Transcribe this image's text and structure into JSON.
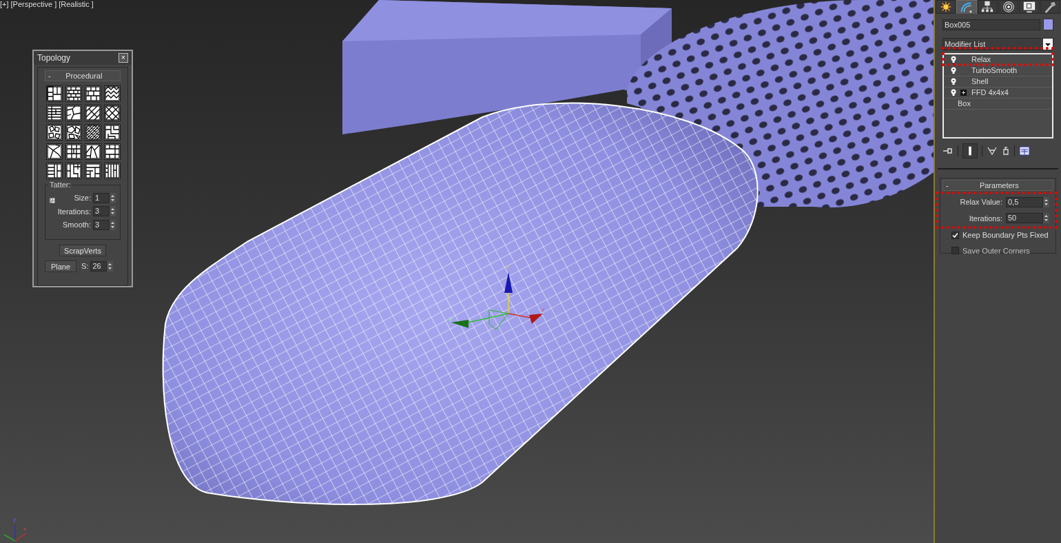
{
  "viewport": {
    "labels": [
      "[+]",
      "[Perspective ]",
      "[Realistic ]"
    ],
    "gizmo_labels": [
      "z",
      "x",
      "y"
    ],
    "corner_axis_labels": [
      "z",
      "x"
    ]
  },
  "topology": {
    "title": "Topology",
    "close": "×",
    "section": {
      "toggle": "-",
      "title": "Procedural"
    },
    "tatter": {
      "title": "Tatter:",
      "fields": [
        {
          "label": "Size:",
          "value": "1"
        },
        {
          "label": "Iterations:",
          "value": "3"
        },
        {
          "label": "Smooth:",
          "value": "3"
        }
      ]
    },
    "scrap_button": "ScrapVerts",
    "plane_button": "Plane",
    "s_field": {
      "label": "S:",
      "value": "26"
    }
  },
  "command_panel": {
    "tabs": [
      {
        "kind": "create",
        "selected": false
      },
      {
        "kind": "modify",
        "selected": true
      },
      {
        "kind": "hierarchy",
        "selected": false
      },
      {
        "kind": "motion",
        "selected": false
      },
      {
        "kind": "display",
        "selected": false
      },
      {
        "kind": "utilities",
        "selected": false
      }
    ],
    "object_name": "Box005",
    "modifier_list": "Modifier List",
    "stack": [
      {
        "kind": "modifier",
        "label": "Relax",
        "expandable": false,
        "highlighted": true
      },
      {
        "kind": "modifier",
        "label": "TurboSmooth",
        "expandable": false,
        "highlighted": false
      },
      {
        "kind": "modifier",
        "label": "Shell",
        "expandable": false,
        "highlighted": false
      },
      {
        "kind": "modifier",
        "label": "FFD 4x4x4",
        "expandable": true,
        "highlighted": false
      },
      {
        "kind": "base",
        "label": "Box",
        "expandable": false,
        "highlighted": false
      }
    ],
    "parameters": {
      "toggle": "-",
      "title": "Parameters",
      "highlighted": true,
      "spinners": [
        {
          "label": "Relax Value:",
          "value": "0,5"
        },
        {
          "label": "Iterations:",
          "value": "50"
        }
      ],
      "checkboxes": [
        {
          "label": "Keep Boundary Pts Fixed",
          "checked": true
        },
        {
          "label": "Save Outer Corners",
          "checked": false
        }
      ]
    }
  }
}
